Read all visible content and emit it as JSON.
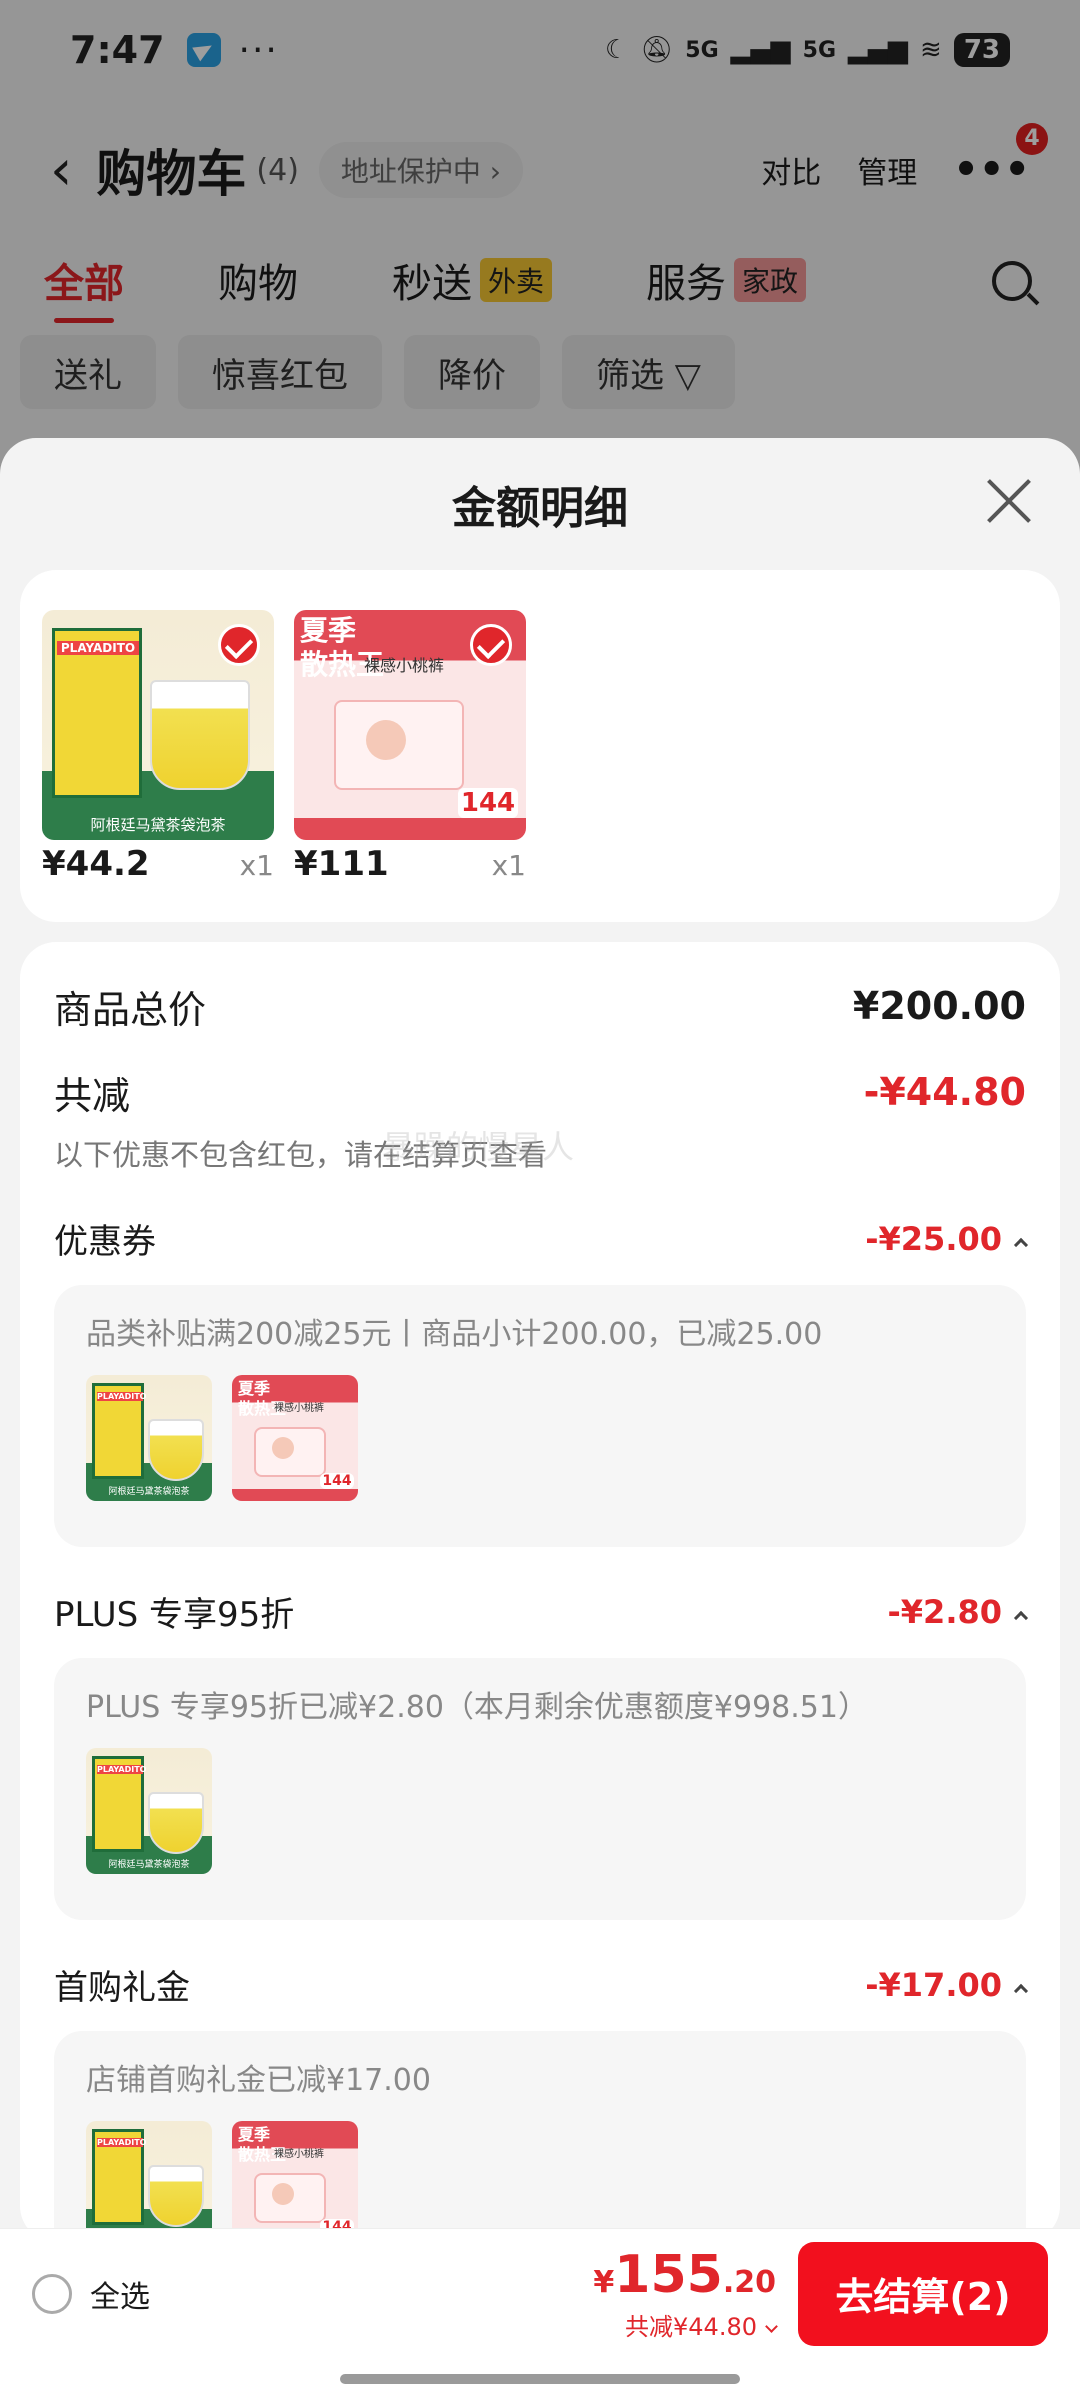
{
  "status_bar": {
    "time": "7:47",
    "dots": "···",
    "net1": "5G",
    "net2": "5G",
    "battery": "73"
  },
  "header": {
    "back": "‹",
    "title": "购物车",
    "count": "(4)",
    "address": "地址保护中 ›",
    "compare": "对比",
    "manage": "管理",
    "more_badge": "4"
  },
  "tabs": [
    {
      "label": "全部"
    },
    {
      "label": "购物"
    },
    {
      "label": "秒送",
      "tag": "外卖"
    },
    {
      "label": "服务",
      "tag": "家政"
    }
  ],
  "chips": [
    "送礼",
    "惊喜红包",
    "降价",
    "筛选 ▽"
  ],
  "sheet": {
    "title": "金额明细",
    "products": [
      {
        "price": "¥44.2",
        "qty": "x1",
        "brand": "PLAYADITO",
        "band": "阿根廷马黛茶袋泡茶"
      },
      {
        "price": "¥111",
        "qty": "x1",
        "banner": "夏季\n散热王",
        "name": "裸感小桃裤",
        "deal": "144"
      }
    ],
    "goods_total_label": "商品总价",
    "goods_total": "¥200.00",
    "discount_label": "共减",
    "discount_total": "-¥44.80",
    "discount_note": "以下优惠不包含红包，请在结算页查看",
    "watermark": "暴躁的慢星人",
    "coupon": {
      "label": "优惠券",
      "value": "-¥25.00",
      "detail": "品类补贴满200减25元丨商品小计200.00，已减25.00"
    },
    "plus": {
      "label": "PLUS 专享95折",
      "value": "-¥2.80",
      "detail": "PLUS 专享95折已减¥2.80（本月剩余优惠额度¥998.51）"
    },
    "first": {
      "label": "首购礼金",
      "value": "-¥17.00",
      "detail": "店铺首购礼金已减¥17.00"
    }
  },
  "footer": {
    "select_all": "全选",
    "currency": "¥",
    "total_int": "155",
    "total_dec": ".20",
    "saved": "共减¥44.80",
    "checkout": "去结算(2)"
  },
  "colors": {
    "accent": "#e0262b",
    "checkout_bg": "#f2101e"
  }
}
